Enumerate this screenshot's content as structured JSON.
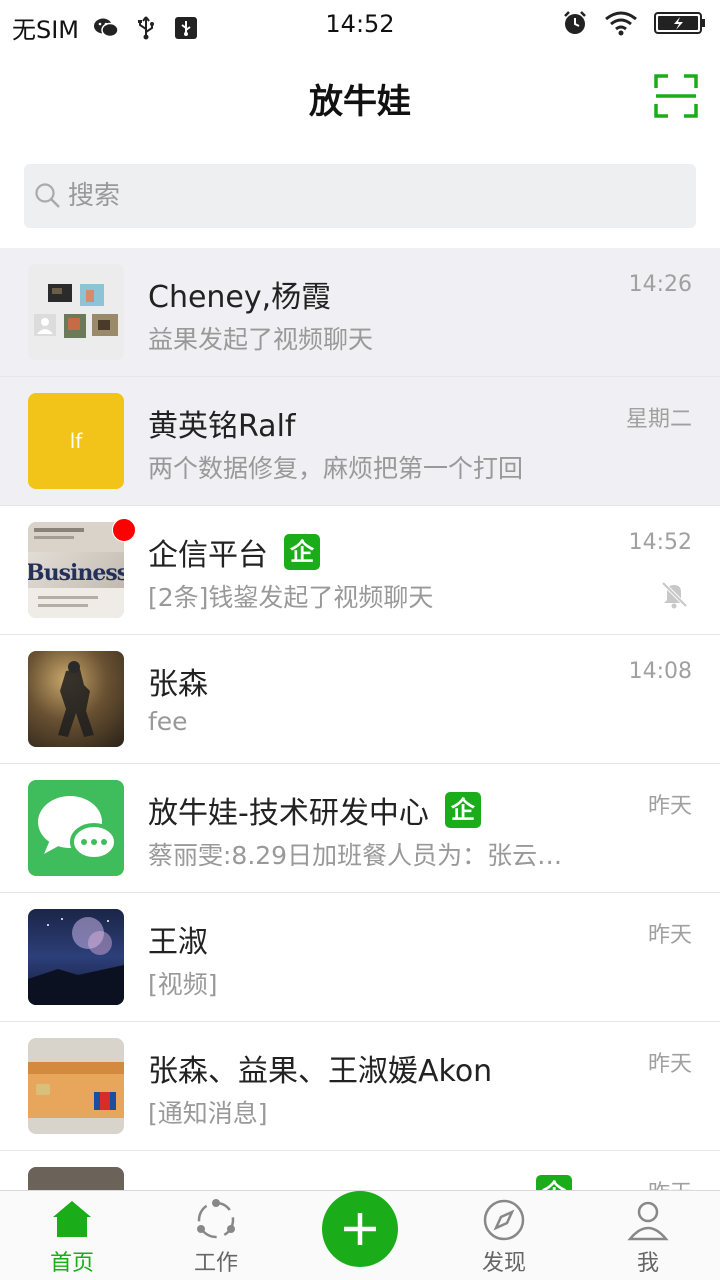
{
  "statusbar": {
    "carrier": "无SIM",
    "time": "14:52"
  },
  "header": {
    "title": "放牛娃"
  },
  "search": {
    "placeholder": "搜索"
  },
  "chats": [
    {
      "name": "Cheney,杨霞",
      "preview": "益果发起了视频聊天",
      "time": "14:26",
      "pinned": true
    },
    {
      "name": "黄英铭Ralf",
      "preview": "两个数据修复，麻烦把第一个打回",
      "time": "星期二",
      "pinned": true,
      "avatar_text": "lf"
    },
    {
      "name": "企信平台",
      "badge": "企",
      "preview": "[2条]钱鋆发起了视频聊天",
      "time": "14:52",
      "muted": true,
      "unread_dot": true,
      "avatar_text": "Business"
    },
    {
      "name": "张森",
      "preview": "fee",
      "time": "14:08"
    },
    {
      "name": "放牛娃-技术研发中心",
      "badge": "企",
      "preview": "蔡丽雯:8.29日加班餐人员为：张云…",
      "time": "昨天"
    },
    {
      "name": "王淑",
      "preview": "[视频]",
      "time": "昨天"
    },
    {
      "name": "张森、益果、王淑媛Akon",
      "preview": "[通知消息]",
      "time": "昨天"
    },
    {
      "name": "",
      "badge": "企",
      "preview": "",
      "time": "昨天"
    }
  ],
  "tabs": [
    {
      "label": "首页",
      "icon": "home-icon",
      "active": true
    },
    {
      "label": "工作",
      "icon": "work-icon"
    },
    {
      "label": "发现",
      "icon": "compass-icon"
    },
    {
      "label": "我",
      "icon": "person-icon"
    }
  ],
  "colors": {
    "accent": "#1aad19",
    "pinned_bg": "#f0f0f4",
    "unread": "#ff0000"
  }
}
